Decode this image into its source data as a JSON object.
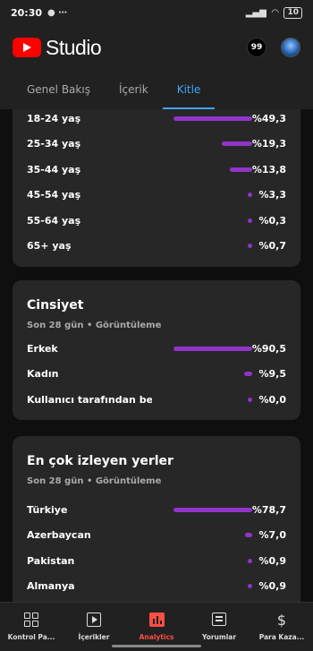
{
  "status_bar": {
    "time": "20:30",
    "battery": "10"
  },
  "app": {
    "brand": "Studio",
    "notification_count": "99"
  },
  "tabs": [
    {
      "label": "Genel Bakış",
      "active": false
    },
    {
      "label": "İçerik",
      "active": false
    },
    {
      "label": "Kitle",
      "active": true
    }
  ],
  "age_card": {
    "rows": [
      {
        "label": "18-24 yaş",
        "percent": "%49,3",
        "share": 0.85
      },
      {
        "label": "25-34 yaş",
        "percent": "%19,3",
        "share": 0.33
      },
      {
        "label": "35-44 yaş",
        "percent": "%13,8",
        "share": 0.24
      },
      {
        "label": "45-54 yaş",
        "percent": "%3,3",
        "share": 0.05
      },
      {
        "label": "55-64 yaş",
        "percent": "%0,3",
        "share": 0.05
      },
      {
        "label": "65+ yaş",
        "percent": "%0,7",
        "share": 0.05
      }
    ]
  },
  "gender_card": {
    "title": "Cinsiyet",
    "subtitle": "Son 28 gün • Görüntüleme",
    "rows": [
      {
        "label": "Erkek",
        "percent": "%90,5",
        "share": 0.85
      },
      {
        "label": "Kadın",
        "percent": "%9,5",
        "share": 0.09
      },
      {
        "label": "Kullanıcı tarafından belir...",
        "percent": "%0,0",
        "share": 0.05
      }
    ]
  },
  "places_card": {
    "title": "En çok izleyen yerler",
    "subtitle": "Son 28 gün • Görüntüleme",
    "rows": [
      {
        "label": "Türkiye",
        "percent": "%78,7",
        "share": 0.85
      },
      {
        "label": "Azerbaycan",
        "percent": "%7,0",
        "share": 0.08
      },
      {
        "label": "Pakistan",
        "percent": "%0,9",
        "share": 0.05
      },
      {
        "label": "Almanya",
        "percent": "%0,9",
        "share": 0.05
      }
    ]
  },
  "bottom_nav": [
    {
      "label": "Kontrol Pa...",
      "icon": "dashboard-icon",
      "active": false
    },
    {
      "label": "İçerikler",
      "icon": "content-icon",
      "active": false
    },
    {
      "label": "Analytics",
      "icon": "analytics-icon",
      "active": true
    },
    {
      "label": "Yorumlar",
      "icon": "comments-icon",
      "active": false
    },
    {
      "label": "Para Kaza...",
      "icon": "earn-icon",
      "active": false
    }
  ],
  "colors": {
    "bar": "#9134c7",
    "accent_tab": "#3ea6ff",
    "nav_active": "#ff4e45"
  }
}
